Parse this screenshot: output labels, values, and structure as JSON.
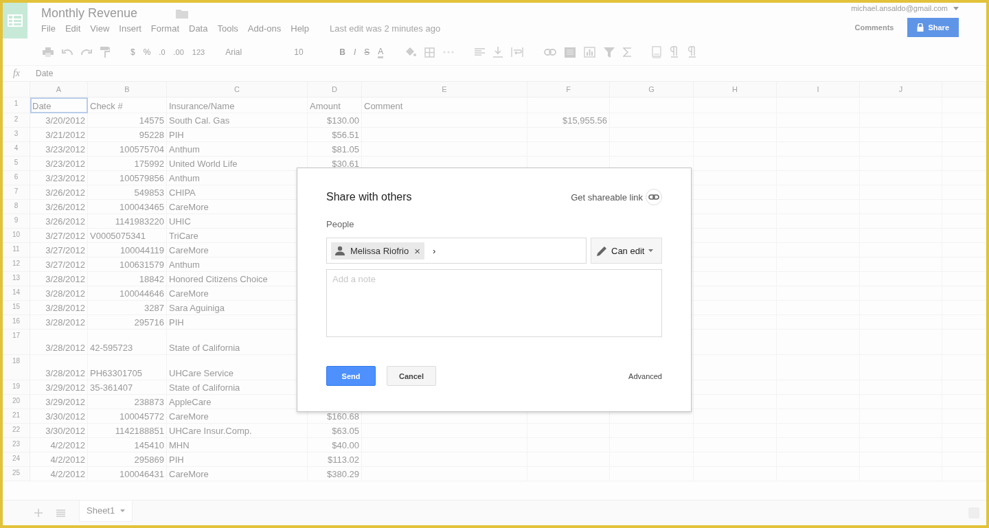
{
  "app": {
    "title": "Monthly Revenue",
    "menu": [
      "File",
      "Edit",
      "View",
      "Insert",
      "Format",
      "Data",
      "Tools",
      "Add-ons",
      "Help"
    ],
    "last_edit": "Last edit was 2 minutes ago",
    "account": "michael.ansaldo@gmail.com",
    "comments_button": "Comments",
    "share_button": "Share"
  },
  "toolbar": {
    "currency": "$",
    "percent": "%",
    "decrease_decimals": ".0",
    "increase_decimals": ".00",
    "number_format": "123",
    "font": "Arial",
    "font_size": "10",
    "bold": "B",
    "italic": "I",
    "strikethrough": "S",
    "text_color": "A"
  },
  "formula_bar": {
    "label": "fx",
    "value": "Date"
  },
  "grid": {
    "columns": [
      "A",
      "B",
      "C",
      "D",
      "E",
      "F",
      "G",
      "H",
      "I",
      "J"
    ],
    "rows": [
      {
        "n": "1",
        "kind": "header",
        "a_selected": true,
        "a": "Date",
        "b": "Check #",
        "c": "Insurance/Name",
        "d": "Amount",
        "e": "Comment"
      },
      {
        "n": "2",
        "kind": "data",
        "a_selected": false,
        "a": "3/20/2012",
        "b": "14575",
        "b_text": false,
        "c": "South Cal. Gas",
        "d": "$130.00",
        "f": "$15,955.56"
      },
      {
        "n": "3",
        "kind": "data",
        "a_selected": false,
        "a": "3/21/2012",
        "b": "95228",
        "b_text": false,
        "c": "PIH",
        "d": "$56.51"
      },
      {
        "n": "4",
        "kind": "data",
        "a_selected": false,
        "a": "3/23/2012",
        "b": "100575704",
        "b_text": false,
        "c": "Anthum",
        "d": "$81.05"
      },
      {
        "n": "5",
        "kind": "data",
        "a_selected": false,
        "a": "3/23/2012",
        "b": "175992",
        "b_text": false,
        "c": "United World Life",
        "d": "$30.61"
      },
      {
        "n": "6",
        "kind": "data",
        "a_selected": false,
        "a": "3/23/2012",
        "b": "100579856",
        "b_text": false,
        "c": "Anthum"
      },
      {
        "n": "7",
        "kind": "data",
        "a_selected": false,
        "a": "3/26/2012",
        "b": "549853",
        "b_text": false,
        "c": "CHIPA"
      },
      {
        "n": "8",
        "kind": "data",
        "a_selected": false,
        "a": "3/26/2012",
        "b": "100043465",
        "b_text": false,
        "c": "CareMore"
      },
      {
        "n": "9",
        "kind": "data",
        "a_selected": false,
        "a": "3/26/2012",
        "b": "1141983220",
        "b_text": false,
        "c": "UHIC"
      },
      {
        "n": "10",
        "kind": "data",
        "a_selected": false,
        "a": "3/27/2012",
        "b": "V0005075341",
        "b_text": true,
        "c": "TriCare"
      },
      {
        "n": "11",
        "kind": "data",
        "a_selected": false,
        "a": "3/27/2012",
        "b": "100044119",
        "b_text": false,
        "c": "CareMore"
      },
      {
        "n": "12",
        "kind": "data",
        "a_selected": false,
        "a": "3/27/2012",
        "b": "100631579",
        "b_text": false,
        "c": "Anthum"
      },
      {
        "n": "13",
        "kind": "data",
        "a_selected": false,
        "a": "3/28/2012",
        "b": "18842",
        "b_text": false,
        "c": "Honored Citizens Choice"
      },
      {
        "n": "14",
        "kind": "data",
        "a_selected": false,
        "a": "3/28/2012",
        "b": "100044646",
        "b_text": false,
        "c": "CareMore"
      },
      {
        "n": "15",
        "kind": "data",
        "a_selected": false,
        "a": "3/28/2012",
        "b": "3287",
        "b_text": false,
        "c": "Sara Aguiniga"
      },
      {
        "n": "16",
        "kind": "data",
        "a_selected": false,
        "a": "3/28/2012",
        "b": "295716",
        "b_text": false,
        "c": "PIH"
      },
      {
        "n": "17",
        "kind": "data",
        "tall": true,
        "a_selected": false,
        "a": "3/28/2012",
        "b": "42-595723",
        "b_text": true,
        "c": "State of California"
      },
      {
        "n": "18",
        "kind": "data",
        "tall": true,
        "a_selected": false,
        "a": "3/28/2012",
        "b": "PH63301705",
        "b_text": true,
        "c": "UHCare Service"
      },
      {
        "n": "19",
        "kind": "data",
        "a_selected": false,
        "a": "3/29/2012",
        "b": "35-361407",
        "b_text": true,
        "c": "State of California"
      },
      {
        "n": "20",
        "kind": "data",
        "a_selected": false,
        "a": "3/29/2012",
        "b": "238873",
        "b_text": false,
        "c": "AppleCare"
      },
      {
        "n": "21",
        "kind": "data",
        "a_selected": false,
        "a": "3/30/2012",
        "b": "100045772",
        "b_text": false,
        "c": "CareMore",
        "d": "$160.68"
      },
      {
        "n": "22",
        "kind": "data",
        "a_selected": false,
        "a": "3/30/2012",
        "b": "1142188851",
        "b_text": false,
        "c": "UHCare Insur.Comp.",
        "d": "$63.05"
      },
      {
        "n": "23",
        "kind": "data",
        "a_selected": false,
        "a": "4/2/2012",
        "b": "145410",
        "b_text": false,
        "c": "MHN",
        "d": "$40.00"
      },
      {
        "n": "24",
        "kind": "data",
        "a_selected": false,
        "a": "4/2/2012",
        "b": "295869",
        "b_text": false,
        "c": "PIH",
        "d": "$113.02"
      },
      {
        "n": "25",
        "kind": "data",
        "a_selected": false,
        "a": "4/2/2012",
        "b": "100046431",
        "b_text": false,
        "c": "CareMore",
        "d": "$380.29"
      }
    ]
  },
  "sheet_tabs": [
    {
      "label": "Sheet1",
      "selected": true
    }
  ],
  "dialog": {
    "title": "Share with others",
    "shareable_link": "Get shareable link",
    "people_label": "People",
    "recipients": [
      {
        "name": "Melissa Riofrio",
        "remove": "×"
      }
    ],
    "input_value": "›",
    "permission": "Can edit",
    "note_placeholder": "Add a note",
    "send_button": "Send",
    "cancel_button": "Cancel",
    "advanced_link": "Advanced"
  }
}
